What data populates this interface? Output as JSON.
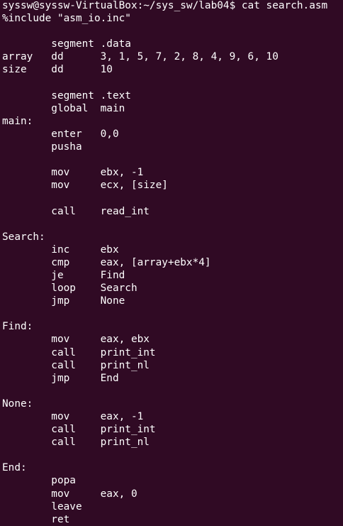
{
  "terminal": {
    "background": "#300a24",
    "foreground": "#ffffff",
    "lines": [
      "syssw@syssw-VirtualBox:~/sys_sw/lab04$ cat search.asm",
      "%include \"asm_io.inc\"",
      "",
      "        segment .data",
      "array   dd      3, 1, 5, 7, 2, 8, 4, 9, 6, 10",
      "size    dd      10",
      "",
      "        segment .text",
      "        global  main",
      "main:",
      "        enter   0,0",
      "        pusha",
      "",
      "        mov     ebx, -1",
      "        mov     ecx, [size]",
      "",
      "        call    read_int",
      "",
      "Search:",
      "        inc     ebx",
      "        cmp     eax, [array+ebx*4]",
      "        je      Find",
      "        loop    Search",
      "        jmp     None",
      "",
      "Find:",
      "        mov     eax, ebx",
      "        call    print_int",
      "        call    print_nl",
      "        jmp     End",
      "",
      "None:",
      "        mov     eax, -1",
      "        call    print_int",
      "        call    print_nl",
      "",
      "End:",
      "        popa",
      "        mov     eax, 0",
      "        leave",
      "        ret"
    ]
  }
}
